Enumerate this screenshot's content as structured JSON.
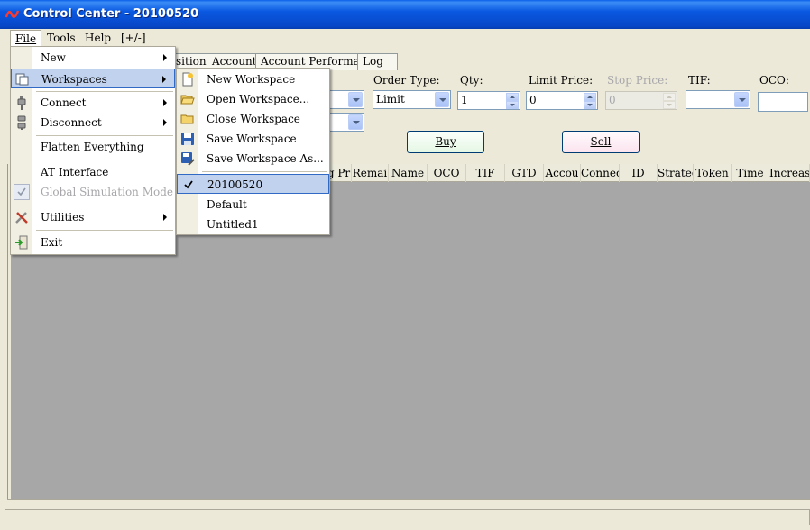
{
  "window": {
    "title": "Control Center - 20100520"
  },
  "menubar": {
    "file": "File",
    "tools": "Tools",
    "help": "Help",
    "plusminus": "[+/-]"
  },
  "tabs": [
    "sitions",
    "Accounts",
    "Account Performance",
    "Log"
  ],
  "order_form": {
    "order_type_label": "Order Type:",
    "order_type_value": "Limit",
    "qty_label": "Qty:",
    "qty_value": "1",
    "limit_price_label": "Limit Price:",
    "limit_price_value": "0",
    "stop_price_label": "Stop Price:",
    "stop_price_value": "0",
    "tif_label": "TIF:",
    "tif_value": "",
    "oco_label": "OCO:",
    "buy_label": "Buy",
    "sell_label": "Sell"
  },
  "grid": {
    "columns": [
      "g Pr",
      "Remai",
      "Name",
      "OCO",
      "TIF",
      "GTD",
      "Accou",
      "Connec",
      "ID",
      "Strateg",
      "Token",
      "Time",
      "Increas"
    ]
  },
  "file_menu": {
    "items": [
      "New",
      "Workspaces",
      "Connect",
      "Disconnect",
      "Flatten Everything",
      "AT Interface",
      "Global Simulation Mode",
      "Utilities",
      "Exit"
    ]
  },
  "workspaces_menu": {
    "items": [
      "New Workspace",
      "Open Workspace...",
      "Close Workspace",
      "Save Workspace",
      "Save Workspace As...",
      "20100520",
      "Default",
      "Untitled1"
    ]
  }
}
